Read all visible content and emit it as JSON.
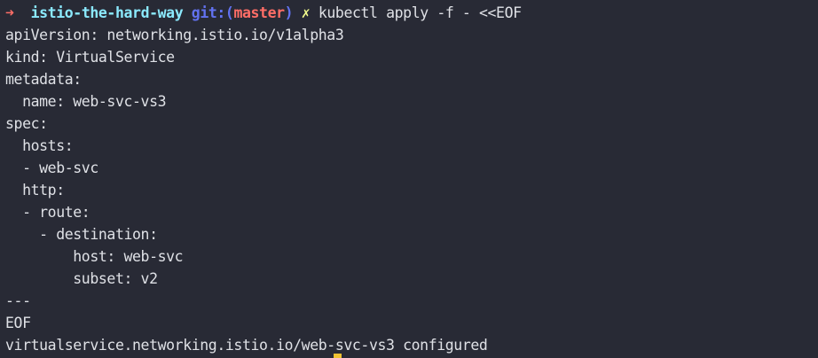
{
  "prompt": {
    "arrow": "➜",
    "directory": "istio-the-hard-way",
    "git_prefix": "git:(",
    "branch": "master",
    "git_suffix": ")",
    "dirty_marker": "✗",
    "command": "kubectl apply -f - <<EOF"
  },
  "input_lines": [
    "apiVersion: networking.istio.io/v1alpha3",
    "kind: VirtualService",
    "metadata:",
    "  name: web-svc-vs3",
    "spec:",
    "  hosts:",
    "  - web-svc",
    "  http:",
    "  - route:",
    "    - destination:",
    "        host: web-svc",
    "        subset: v2",
    "---",
    "EOF"
  ],
  "output_lines": [
    "virtualservice.networking.istio.io/web-svc-vs3 configured"
  ],
  "colors": {
    "background": "#282a35",
    "text": "#dfe1e6",
    "arrow": "#ff6e67",
    "directory": "#8be9fd",
    "git": "#6272f0",
    "branch": "#ff6e67",
    "dirty": "#f1fa8c",
    "cursor": "#f1c232"
  }
}
